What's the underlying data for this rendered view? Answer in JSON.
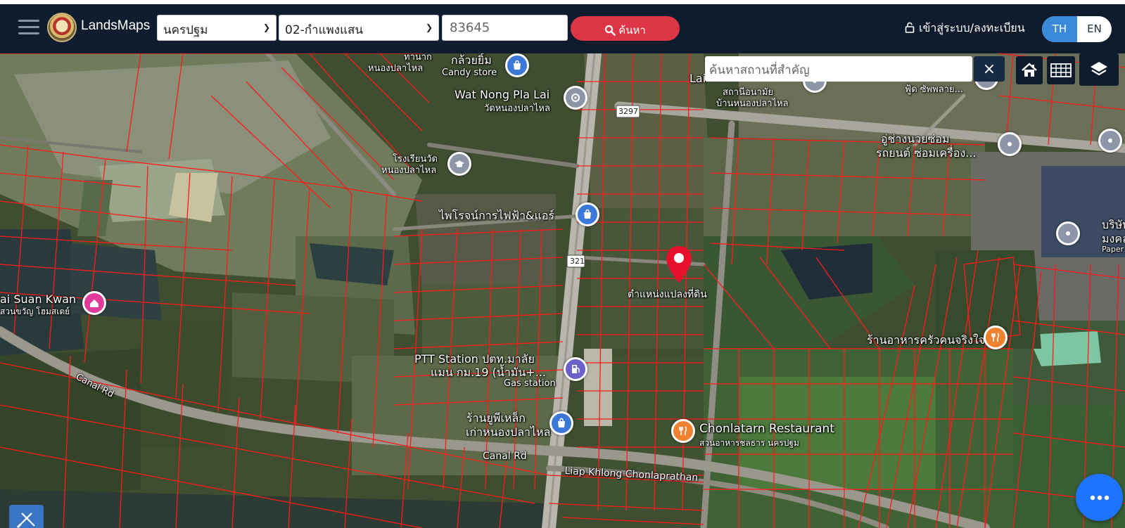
{
  "header": {
    "brand": "LandsMaps",
    "province": "นครปฐม",
    "district": "02-กำแพงแสน",
    "parcel_number": "83645",
    "search_button": "ค้นหา",
    "login": "เข้าสู่ระบบ/ลงทะเบียน",
    "lang_th": "TH",
    "lang_en": "EN"
  },
  "map_controls": {
    "place_search_placeholder": "ค้นหาสถานที่สำคัญ",
    "clear_symbol": "×"
  },
  "map_labels": {
    "top_cut": "ทานาก",
    "top_cut2": "หนองปลาไหล",
    "kluay_yim": "กล้วยยิ้ม",
    "candy_store": "Candy store",
    "wat_en": "Wat Nong Pla Lai",
    "wat_th": "วัดหนองปลาไหล",
    "road_3297": "3297",
    "lai_cut": "Lai",
    "school_cut1": "สถานีอนามัย",
    "school_cut2": "บ้านหนองปลาไหล",
    "food_cut": "ฟู้ด ซัพพลาย...",
    "garage1": "อู่ช่างนวยซ่อม",
    "garage2": "รถยนต์ ซ่อมเครื่อง...",
    "school_a": "โรงเรียนวัด",
    "school_b": "หนองปลาไหล",
    "electric": "ไพโรจน์การไฟฟ้า&แอร์",
    "road_321": "321",
    "company1": "บริษัท",
    "company2": "มงคล",
    "company3": "Paper m",
    "suan_kwan": "ai Suan Kwan",
    "suan_kwan_th": "สวนขวัญ โฮมสเตย์",
    "parcel_pos": "ตำแหน่งแปลงที่ดิน",
    "restaurant_th": "ร้านอาหารครัวคนจริงใจ",
    "canal_rd_left": "Canal Rd",
    "ptt1": "PTT Station ปตท.มาลัย",
    "ptt2": "แมน กม.19 (น้ำมัน+...",
    "gas_station": "Gas station",
    "scrap1": "ร้านยูพีเหล็ก",
    "scrap2": "เก่าหนองปลาไหล",
    "chonlatarn": "Chonlatarn Restaurant",
    "chonlatarn_th": "สวนอาหารชลธาร นครปฐม",
    "canal_rd_mid": "Canal Rd",
    "liap_khlong": "Liap Khlong Chonlaprathan"
  },
  "icons": {
    "menu": "hamburger-icon",
    "search": "search-icon",
    "lock": "lock-icon",
    "home": "home-icon",
    "grid": "grid-icon",
    "layers": "layers-icon",
    "chat": "more-dots-icon",
    "tool": "pencil-ruler-icon",
    "pin": "location-pin-icon"
  },
  "colors": {
    "navbar": "#0f1c2e",
    "search_button": "#dc3545",
    "lang_active": "#3b8ad9",
    "parcel_lines": "#ff1a1a",
    "pin": "#e8112d",
    "chat": "#1e73ff"
  }
}
